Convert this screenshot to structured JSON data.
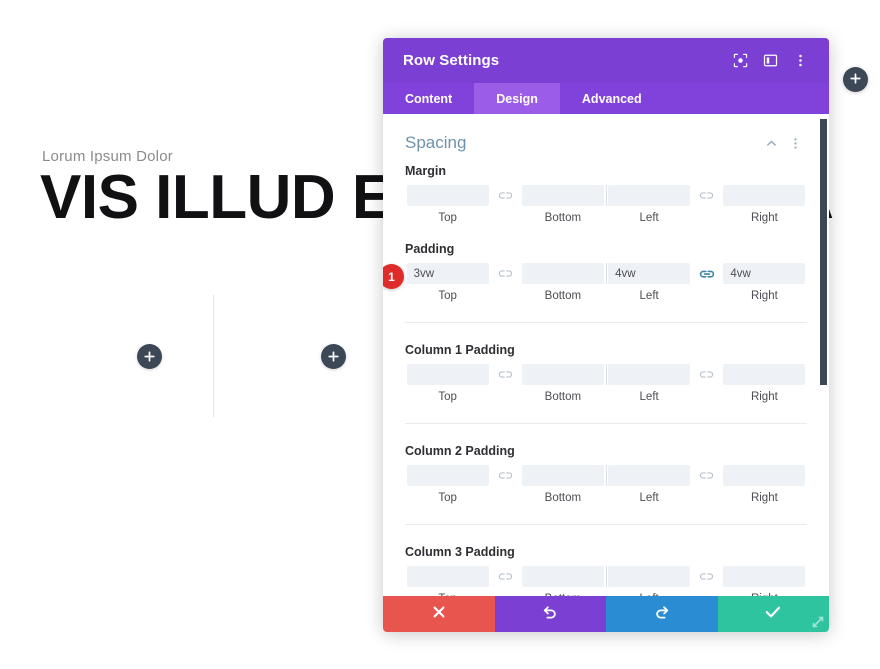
{
  "page": {
    "eyebrow": "Lorum Ipsum Dolor",
    "headline": "VIS ILLUD EX MEDIOCRITA",
    "add_module_left_icon": "plus-icon",
    "add_module_right_icon": "plus-icon",
    "add_section_icon": "plus-icon"
  },
  "modal": {
    "title": "Row Settings",
    "header_icons": [
      {
        "name": "focus-target-icon",
        "label": "Focus"
      },
      {
        "name": "panel-layout-icon",
        "label": "Layout"
      },
      {
        "name": "more-options-icon",
        "label": "More Options"
      }
    ],
    "tabs": [
      {
        "label": "Content",
        "active": false
      },
      {
        "label": "Design",
        "active": true
      },
      {
        "label": "Advanced",
        "active": false
      }
    ],
    "section": {
      "title": "Spacing",
      "collapse_icon": "chevron-up-icon",
      "options_icon": "more-options-icon"
    },
    "sub_labels": {
      "top": "Top",
      "bottom": "Bottom",
      "left": "Left",
      "right": "Right"
    },
    "groups": [
      {
        "label": "Margin",
        "badge": null,
        "top": "",
        "bottom": "",
        "left": "",
        "right": "",
        "placeholder": "",
        "link_tb": "unlinked",
        "link_lr": "unlinked"
      },
      {
        "label": "Padding",
        "badge": "1",
        "top": "3vw",
        "bottom": "",
        "left": "4vw",
        "right": "4vw",
        "placeholder": "",
        "link_tb": "unlinked",
        "link_lr": "linked"
      },
      {
        "label": "Column 1 Padding",
        "badge": null,
        "top": "",
        "bottom": "",
        "left": "",
        "right": "",
        "placeholder": "",
        "link_tb": "unlinked",
        "link_lr": "unlinked"
      },
      {
        "label": "Column 2 Padding",
        "badge": null,
        "top": "",
        "bottom": "",
        "left": "",
        "right": "",
        "placeholder": "",
        "link_tb": "unlinked",
        "link_lr": "unlinked"
      },
      {
        "label": "Column 3 Padding",
        "badge": null,
        "top": "",
        "bottom": "",
        "left": "",
        "right": "",
        "placeholder": "",
        "link_tb": "unlinked",
        "link_lr": "unlinked"
      }
    ],
    "footer": [
      {
        "name": "cancel-button",
        "icon": "close-icon"
      },
      {
        "name": "undo-button",
        "icon": "undo-icon"
      },
      {
        "name": "redo-button",
        "icon": "redo-icon"
      },
      {
        "name": "save-button",
        "icon": "check-icon"
      }
    ],
    "resize_handle_icon": "resize-handle-icon"
  },
  "colors": {
    "header_purple": "#7B3FD4",
    "tabbar_purple": "#8042DB",
    "tab_active_purple": "#9B5CE8",
    "section_title_blue": "#6F93AD",
    "input_bg": "#EEF2F6",
    "link_active": "#3E87A8",
    "link_inactive": "#AEB8C2",
    "badge_red": "#E02B2B",
    "footer_cancel": "#E8554E",
    "footer_undo": "#7B3FD4",
    "footer_redo": "#2A8DD4",
    "footer_save": "#2EC4A0",
    "add_button": "#3C4856"
  }
}
